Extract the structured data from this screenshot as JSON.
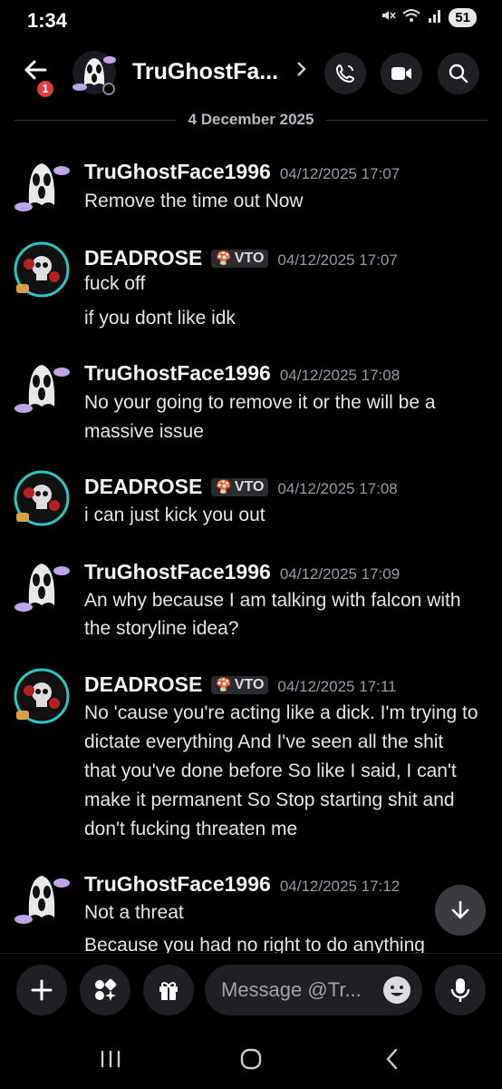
{
  "status": {
    "time": "1:34",
    "battery": "51"
  },
  "header": {
    "title": "TruGhostFace1996",
    "title_display": "TruGhostFa...",
    "back_badge": "1"
  },
  "date_divider": "4 December 2025",
  "messages": [
    {
      "username": "TruGhostFace1996",
      "timestamp": "04/12/2025 17:07",
      "lines": [
        "Remove the time out Now"
      ]
    },
    {
      "username": "DEADROSE",
      "tag": "VTO",
      "timestamp": "04/12/2025 17:07",
      "lines": [
        "fuck off",
        "if you dont like idk"
      ]
    },
    {
      "username": "TruGhostFace1996",
      "timestamp": "04/12/2025 17:08",
      "lines": [
        "No your going to remove it or the will be a",
        "massive issue"
      ]
    },
    {
      "username": "DEADROSE",
      "tag": "VTO",
      "timestamp": "04/12/2025 17:08",
      "lines": [
        "i can just kick you out"
      ]
    },
    {
      "username": "TruGhostFace1996",
      "timestamp": "04/12/2025 17:09",
      "lines": [
        "An why because I am talking with falcon with",
        "the storyline idea?"
      ]
    },
    {
      "username": "DEADROSE",
      "tag": "VTO",
      "timestamp": "04/12/2025 17:11",
      "lines": [
        "No 'cause you're acting like a dick. I'm trying to",
        "dictate everything And I've seen all the shit",
        "that you've done before So like I said, I can't",
        "make it permanent So Stop starting shit and",
        "don't fucking threaten me"
      ]
    },
    {
      "username": "TruGhostFace1996",
      "timestamp": "04/12/2025 17:12",
      "lines": [
        "Not a threat",
        "Because you had no right to do anything"
      ]
    }
  ],
  "composer": {
    "placeholder": "Message @Tr..."
  },
  "icons": {
    "back": "arrow-left-icon",
    "call": "phone-icon",
    "video": "video-camera-icon",
    "search": "search-icon",
    "scroll": "arrow-down-icon",
    "plus": "plus-icon",
    "apps": "apps-icon",
    "gift": "gift-icon",
    "emoji": "emoji-icon",
    "mic": "microphone-icon"
  },
  "colors": {
    "background": "#000000",
    "button_bg": "#1f1f24",
    "badge_red": "#e03c3c",
    "timestamp": "#949ba4"
  }
}
